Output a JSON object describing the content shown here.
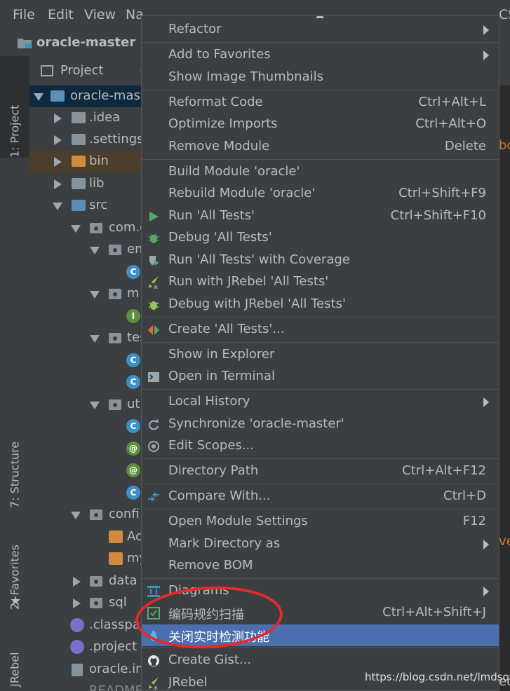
{
  "menubar": {
    "items": [
      "File",
      "Edit",
      "View",
      "Na"
    ],
    "mnemonics": [
      "F",
      "E",
      "V",
      "N"
    ],
    "right_fragment": "CS"
  },
  "project_name": "oracle-master",
  "project_panel": {
    "title": "Project"
  },
  "tool_tabs": {
    "project": "1: Project",
    "structure": "7: Structure",
    "favorites": "2: Favorites",
    "jrebel": "JRebel"
  },
  "tree": [
    {
      "label": "oracle-mast",
      "icon": "module-folder-icon"
    },
    {
      "label": ".idea",
      "icon": "folder-icon"
    },
    {
      "label": ".settings",
      "icon": "folder-icon"
    },
    {
      "label": "bin",
      "icon": "excluded-folder-icon"
    },
    {
      "label": "lib",
      "icon": "folder-icon"
    },
    {
      "label": "src",
      "icon": "source-folder-icon"
    },
    {
      "label": "com.o",
      "icon": "package-icon"
    },
    {
      "label": "en",
      "icon": "package-icon"
    },
    {
      "label": "C",
      "icon": "class-icon"
    },
    {
      "label": "m",
      "icon": "package-icon"
    },
    {
      "label": "I",
      "icon": "interface-icon"
    },
    {
      "label": "tes",
      "icon": "package-icon"
    },
    {
      "label": "C",
      "icon": "class-icon"
    },
    {
      "label": "C",
      "icon": "class-icon"
    },
    {
      "label": "ut",
      "icon": "package-icon"
    },
    {
      "label": "C",
      "icon": "class-icon"
    },
    {
      "label": "@",
      "icon": "annotation-icon"
    },
    {
      "label": "@",
      "icon": "annotation-icon"
    },
    {
      "label": "C",
      "icon": "class-icon"
    },
    {
      "label": "confi",
      "icon": "package-icon"
    },
    {
      "label": "Ac",
      "icon": "xml-file-icon"
    },
    {
      "label": "my",
      "icon": "xml-file-icon"
    },
    {
      "label": "data",
      "icon": "package-icon"
    },
    {
      "label": "sql",
      "icon": "package-icon"
    },
    {
      "label": ".classpat",
      "icon": "file-icon"
    },
    {
      "label": ".project",
      "icon": "file-icon"
    },
    {
      "label": "oracle.im",
      "icon": "iml-file-icon"
    },
    {
      "label": "README",
      "icon": "file-icon"
    }
  ],
  "context_menu": {
    "items": [
      {
        "label": "Refactor",
        "submenu": true
      },
      {
        "label": "Add to Favorites",
        "submenu": true
      },
      {
        "label": "Show Image Thumbnails"
      },
      {
        "label": "Reformat Code",
        "shortcut": "Ctrl+Alt+L"
      },
      {
        "label": "Optimize Imports",
        "shortcut": "Ctrl+Alt+O"
      },
      {
        "label": "Remove Module",
        "shortcut": "Delete"
      },
      {
        "label": "Build Module 'oracle'"
      },
      {
        "label": "Rebuild Module 'oracle'",
        "shortcut": "Ctrl+Shift+F9"
      },
      {
        "label": "Run 'All Tests'",
        "shortcut": "Ctrl+Shift+F10",
        "icon": "run-icon"
      },
      {
        "label": "Debug 'All Tests'",
        "icon": "debug-icon"
      },
      {
        "label": "Run 'All Tests' with Coverage",
        "icon": "coverage-icon"
      },
      {
        "label": "Run with JRebel 'All Tests'",
        "icon": "jrebel-run-icon"
      },
      {
        "label": "Debug with JRebel 'All Tests'",
        "icon": "jrebel-debug-icon"
      },
      {
        "label": "Create 'All Tests'...",
        "icon": "create-config-icon"
      },
      {
        "label": "Show in Explorer"
      },
      {
        "label": "Open in Terminal",
        "icon": "terminal-icon"
      },
      {
        "label": "Local History",
        "submenu": true
      },
      {
        "label": "Synchronize 'oracle-master'",
        "icon": "sync-icon"
      },
      {
        "label": "Edit Scopes...",
        "icon": "scopes-icon"
      },
      {
        "label": "Directory Path",
        "shortcut": "Ctrl+Alt+F12"
      },
      {
        "label": "Compare With...",
        "shortcut": "Ctrl+D",
        "icon": "compare-icon"
      },
      {
        "label": "Open Module Settings",
        "shortcut": "F12"
      },
      {
        "label": "Mark Directory as",
        "submenu": true
      },
      {
        "label": "Remove BOM"
      },
      {
        "label": "Diagrams",
        "submenu": true,
        "icon": "diagram-icon"
      },
      {
        "label": "编码规约扫描",
        "shortcut": "Ctrl+Alt+Shift+J",
        "icon": "p3c-scan-icon"
      },
      {
        "label": "关闭实时检测功能",
        "icon": "p3c-realtime-icon",
        "highlighted": true
      },
      {
        "label": "Create Gist...",
        "icon": "github-icon"
      },
      {
        "label": "JRebel",
        "icon": "jrebel-icon"
      }
    ]
  },
  "editor_fragments": [
    "bo",
    "ve",
    "ec"
  ],
  "watermark": "https://blog.csdn.net/lmdsoft",
  "colors": {
    "menu_bg": "#3c3f41",
    "highlight": "#4b6eaf",
    "annotation_circle": "#e52a2a"
  }
}
